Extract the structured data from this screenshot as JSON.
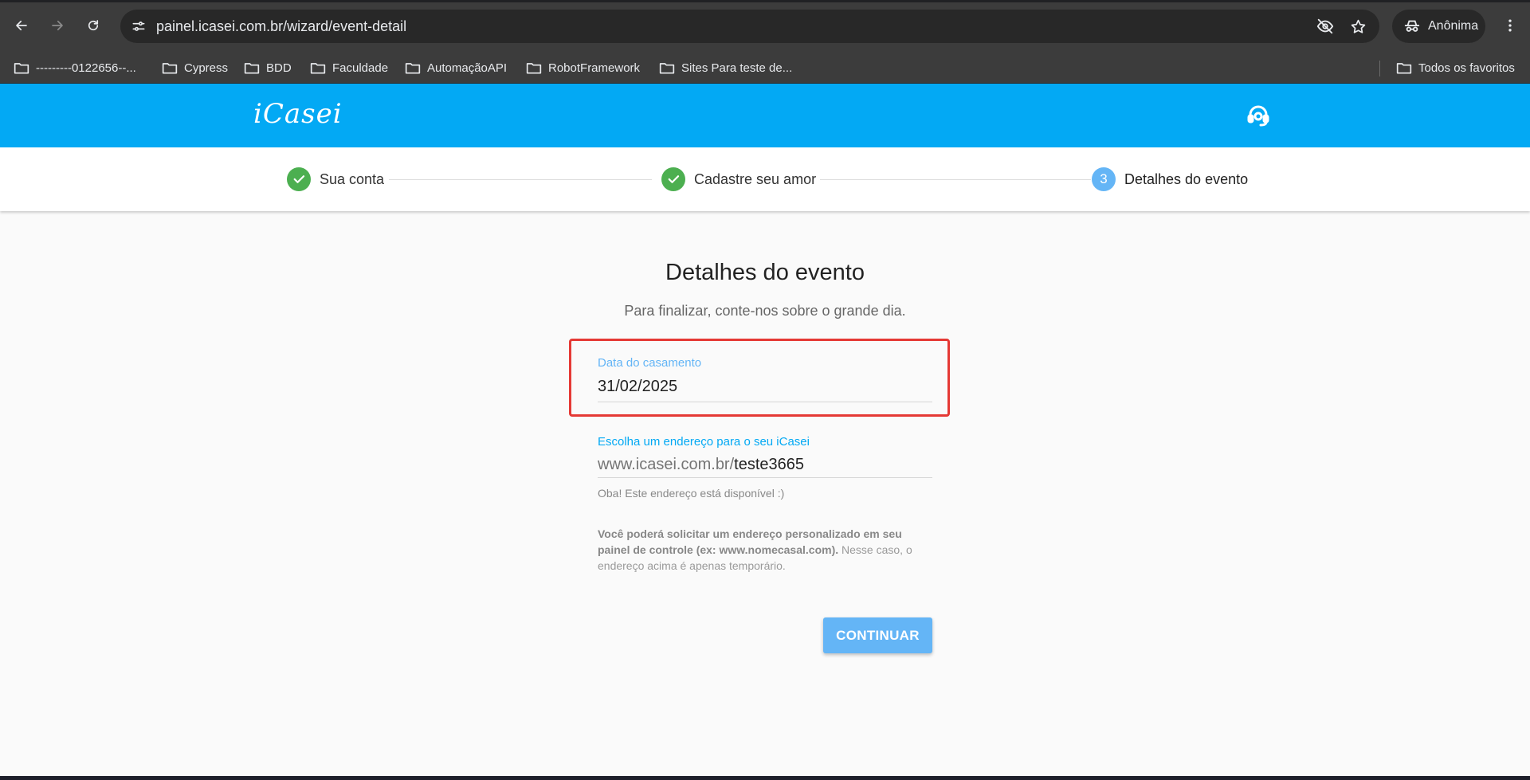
{
  "browser": {
    "url": "painel.icasei.com.br/wizard/event-detail",
    "profile_label": "Anônima",
    "bookmarks": [
      "---------0122656--...",
      "Cypress",
      "BDD",
      "Faculdade",
      "AutomaçãoAPI",
      "RobotFramework",
      "Sites Para teste de..."
    ],
    "all_bookmarks_label": "Todos os favoritos"
  },
  "header": {
    "logo": "iCasei"
  },
  "stepper": {
    "steps": [
      {
        "label": "Sua conta",
        "state": "done"
      },
      {
        "label": "Cadastre seu amor",
        "state": "done"
      },
      {
        "label": "Detalhes do evento",
        "state": "active",
        "number": "3"
      }
    ]
  },
  "content": {
    "title": "Detalhes do evento",
    "subtitle": "Para finalizar, conte-nos sobre o grande dia.",
    "wedding_date": {
      "label": "Data do casamento",
      "value": "31/02/2025"
    },
    "address": {
      "label": "Escolha um endereço para o seu iCasei",
      "prefix": "www.icasei.com.br/",
      "value": "teste3665",
      "helper": "Oba! Este endereço está disponível :)"
    },
    "note": {
      "bold": "Você poderá solicitar um endereço personalizado em seu painel de controle (ex: www.nomecasal.com).",
      "rest": " Nesse caso, o endereço acima é apenas temporário."
    },
    "continue_label": "CONTINUAR"
  },
  "colors": {
    "brand": "#03a9f4",
    "step_done": "#4caf50",
    "step_active": "#64b5f6",
    "highlight": "#e53935"
  }
}
